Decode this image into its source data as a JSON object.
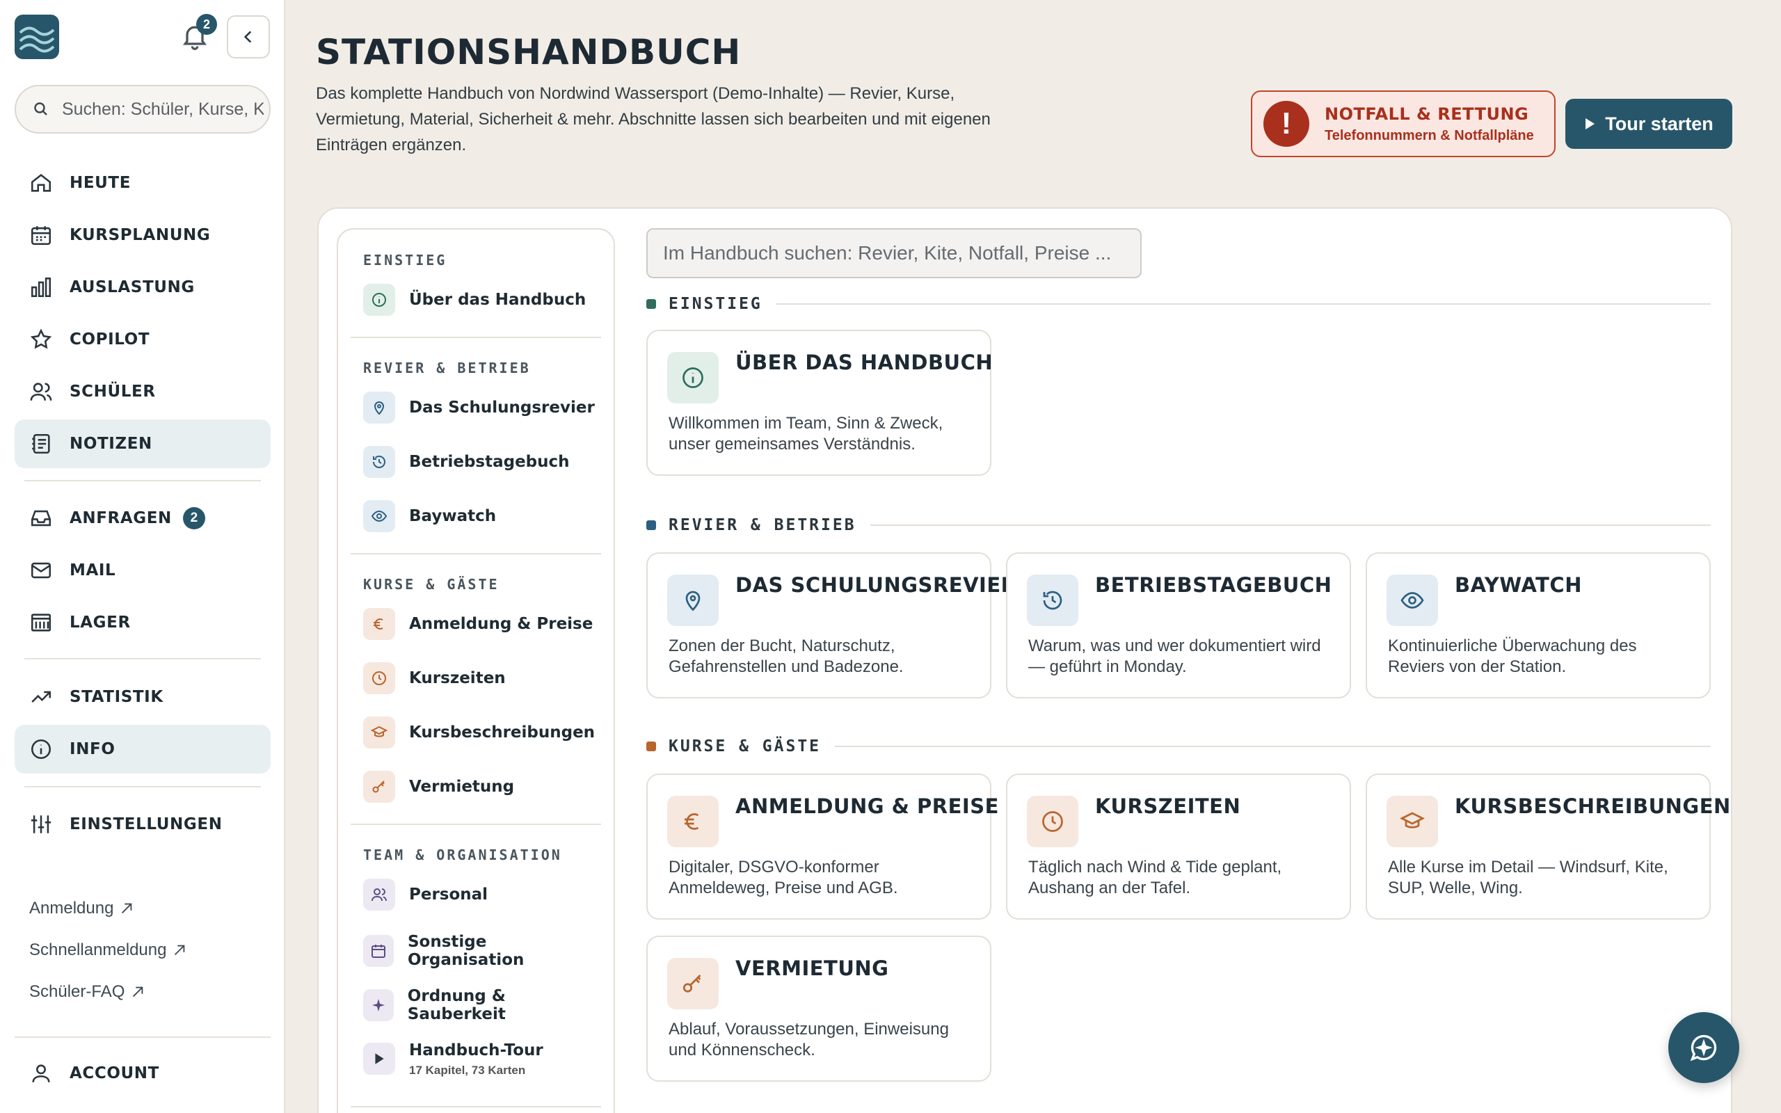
{
  "sidebar": {
    "notification_count": "2",
    "search_placeholder": "Suchen: Schüler, Kurse, Kunden",
    "nav": [
      {
        "label": "HEUTE"
      },
      {
        "label": "KURSPLANUNG"
      },
      {
        "label": "AUSLASTUNG"
      },
      {
        "label": "COPILOT"
      },
      {
        "label": "SCHÜLER"
      },
      {
        "label": "NOTIZEN"
      },
      {
        "label": "ANFRAGEN",
        "badge": "2"
      },
      {
        "label": "MAIL"
      },
      {
        "label": "LAGER"
      },
      {
        "label": "STATISTIK"
      },
      {
        "label": "INFO"
      },
      {
        "label": "EINSTELLUNGEN"
      }
    ],
    "links": [
      {
        "label": "Anmeldung"
      },
      {
        "label": "Schnellanmeldung"
      },
      {
        "label": "Schüler-FAQ"
      }
    ],
    "account_label": "ACCOUNT"
  },
  "header": {
    "title": "STATIONSHANDBUCH",
    "description": "Das komplette Handbuch von Nordwind Wassersport (Demo-Inhalte) — Revier, Kurse, Vermietung, Material, Sicherheit & mehr. Abschnitte lassen sich bearbeiten und mit eigenen Einträgen ergänzen.",
    "emergency_title": "NOTFALL & RETTUNG",
    "emergency_sub": "Telefonnummern & Notfallpläne",
    "tour_button": "Tour starten"
  },
  "toc": {
    "groups": [
      {
        "heading": "EINSTIEG",
        "items": [
          "Über das Handbuch"
        ]
      },
      {
        "heading": "REVIER & BETRIEB",
        "items": [
          "Das Schulungsrevier",
          "Betriebstagebuch",
          "Baywatch"
        ]
      },
      {
        "heading": "KURSE & GÄSTE",
        "items": [
          "Anmeldung & Preise",
          "Kurszeiten",
          "Kursbeschreibungen",
          "Vermietung"
        ]
      },
      {
        "heading": "TEAM & ORGANISATION",
        "items": [
          "Personal",
          "Sonstige Organisation",
          "Ordnung & Sauberkeit",
          "Handbuch-Tour"
        ]
      }
    ],
    "tour_sub": "17 Kapitel, 73 Karten"
  },
  "handbook_search_placeholder": "Im Handbuch suchen: Revier, Kite, Notfall, Preise ...",
  "sections": [
    {
      "label": "EINSTIEG",
      "color": "#2e6e5c",
      "cards": [
        {
          "title": "ÜBER DAS HANDBUCH",
          "desc": "Willkommen im Team, Sinn & Zweck, unser gemeinsames Verständnis.",
          "icon": "info-icon"
        }
      ]
    },
    {
      "label": "REVIER & BETRIEB",
      "color": "#2d5f82",
      "cards": [
        {
          "title": "DAS SCHULUNGSREVIER",
          "desc": "Zonen der Bucht, Naturschutz, Gefahrenstellen und Badezone.",
          "icon": "map-pin-icon"
        },
        {
          "title": "BETRIEBSTAGEBUCH",
          "desc": "Warum, was und wer dokumentiert wird — geführt in Monday.",
          "icon": "history-icon"
        },
        {
          "title": "BAYWATCH",
          "desc": "Kontinuierliche Überwachung des Reviers von der Station.",
          "icon": "eye-icon"
        }
      ]
    },
    {
      "label": "KURSE & GÄSTE",
      "color": "#b8652e",
      "cards": [
        {
          "title": "ANMELDUNG & PREISE",
          "desc": "Digitaler, DSGVO-konformer Anmeldeweg, Preise und AGB.",
          "icon": "euro-icon"
        },
        {
          "title": "KURSZEITEN",
          "desc": "Täglich nach Wind & Tide geplant, Aushang an der Tafel.",
          "icon": "clock-icon"
        },
        {
          "title": "KURSBESCHREIBUNGEN",
          "desc": "Alle Kurse im Detail — Windsurf, Kite, SUP, Welle, Wing.",
          "icon": "graduation-cap-icon"
        },
        {
          "title": "VERMIETUNG",
          "desc": "Ablauf, Voraussetzungen, Einweisung und Könnenscheck.",
          "icon": "key-icon"
        }
      ]
    }
  ]
}
